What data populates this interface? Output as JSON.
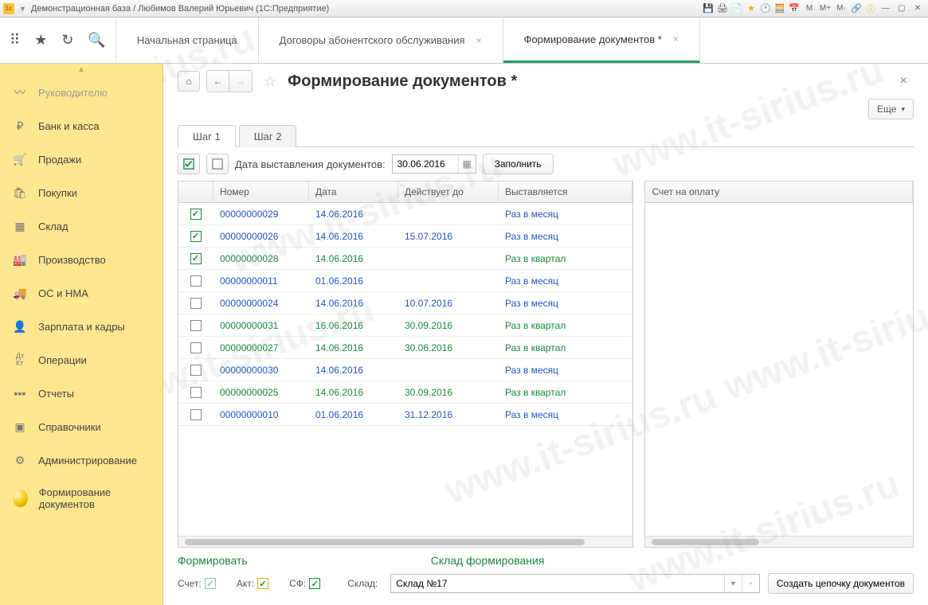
{
  "window": {
    "title": "Демонстрационная база / Любимов Валерий Юрьевич  (1С:Предприятие)"
  },
  "titlebar_buttons": [
    "M",
    "M+",
    "M-"
  ],
  "top_tabs": [
    {
      "label": "Начальная страница",
      "closable": false,
      "active": false
    },
    {
      "label": "Договоры абонентского обслуживания",
      "closable": true,
      "active": false
    },
    {
      "label": "Формирование документов *",
      "closable": true,
      "active": true
    }
  ],
  "sidebar": {
    "items": [
      {
        "label": "Руководителю",
        "icon": "↗",
        "active": true
      },
      {
        "label": "Банк и касса",
        "icon": "₽"
      },
      {
        "label": "Продажи",
        "icon": "🛒"
      },
      {
        "label": "Покупки",
        "icon": "🛍"
      },
      {
        "label": "Склад",
        "icon": "≡"
      },
      {
        "label": "Производство",
        "icon": "🏭"
      },
      {
        "label": "ОС и НМА",
        "icon": "🚚"
      },
      {
        "label": "Зарплата и кадры",
        "icon": "👤"
      },
      {
        "label": "Операции",
        "icon": "Дт"
      },
      {
        "label": "Отчеты",
        "icon": "📊"
      },
      {
        "label": "Справочники",
        "icon": "📚"
      },
      {
        "label": "Администрирование",
        "icon": "⚙"
      },
      {
        "label": "Формирование документов",
        "icon": "ball",
        "current": true
      }
    ]
  },
  "page": {
    "title": "Формирование документов *",
    "more": "Еще"
  },
  "steps": {
    "step1": "Шаг 1",
    "step2": "Шаг 2"
  },
  "toolbar": {
    "date_label": "Дата выставления документов:",
    "date_value": "30.06.2016",
    "fill": "Заполнить"
  },
  "grid_left": {
    "headers": {
      "num": "Номер",
      "date": "Дата",
      "valid": "Действует до",
      "freq": "Выставляется"
    },
    "rows": [
      {
        "chk": true,
        "num": "00000000029",
        "date": "14.06.2016",
        "valid": "",
        "freq": "Раз в месяц",
        "cls": "blue"
      },
      {
        "chk": true,
        "num": "00000000026",
        "date": "14.06.2016",
        "valid": "15.07.2016",
        "freq": "Раз в месяц",
        "cls": "blue"
      },
      {
        "chk": true,
        "num": "00000000028",
        "date": "14.06.2016",
        "valid": "",
        "freq": "Раз в квартал",
        "cls": "green"
      },
      {
        "chk": false,
        "num": "00000000011",
        "date": "01.06.2016",
        "valid": "",
        "freq": "Раз в месяц",
        "cls": "blue"
      },
      {
        "chk": false,
        "num": "00000000024",
        "date": "14.06.2016",
        "valid": "10.07.2016",
        "freq": "Раз в месяц",
        "cls": "blue"
      },
      {
        "chk": false,
        "num": "00000000031",
        "date": "16.06.2016",
        "valid": "30.09.2016",
        "freq": "Раз в квартал",
        "cls": "green"
      },
      {
        "chk": false,
        "num": "00000000027",
        "date": "14.06.2016",
        "valid": "30.06.2016",
        "freq": "Раз в квартал",
        "cls": "green"
      },
      {
        "chk": false,
        "num": "00000000030",
        "date": "14.06.2016",
        "valid": "",
        "freq": "Раз в месяц",
        "cls": "blue"
      },
      {
        "chk": false,
        "num": "00000000025",
        "date": "14.06.2016",
        "valid": "30.09.2016",
        "freq": "Раз в квартал",
        "cls": "green"
      },
      {
        "chk": false,
        "num": "00000000010",
        "date": "01.06.2016",
        "valid": "31.12.2016",
        "freq": "Раз в месяц",
        "cls": "blue"
      }
    ]
  },
  "grid_right": {
    "header": "Счет на оплату"
  },
  "bottom": {
    "form_label": "Формировать",
    "sklad_label": "Склад формирования",
    "schet": "Счет:",
    "akt": "Акт:",
    "sf": "СФ:",
    "sklad_field": "Склад:",
    "sklad_value": "Склад №17",
    "create": "Создать цепочку документов"
  }
}
